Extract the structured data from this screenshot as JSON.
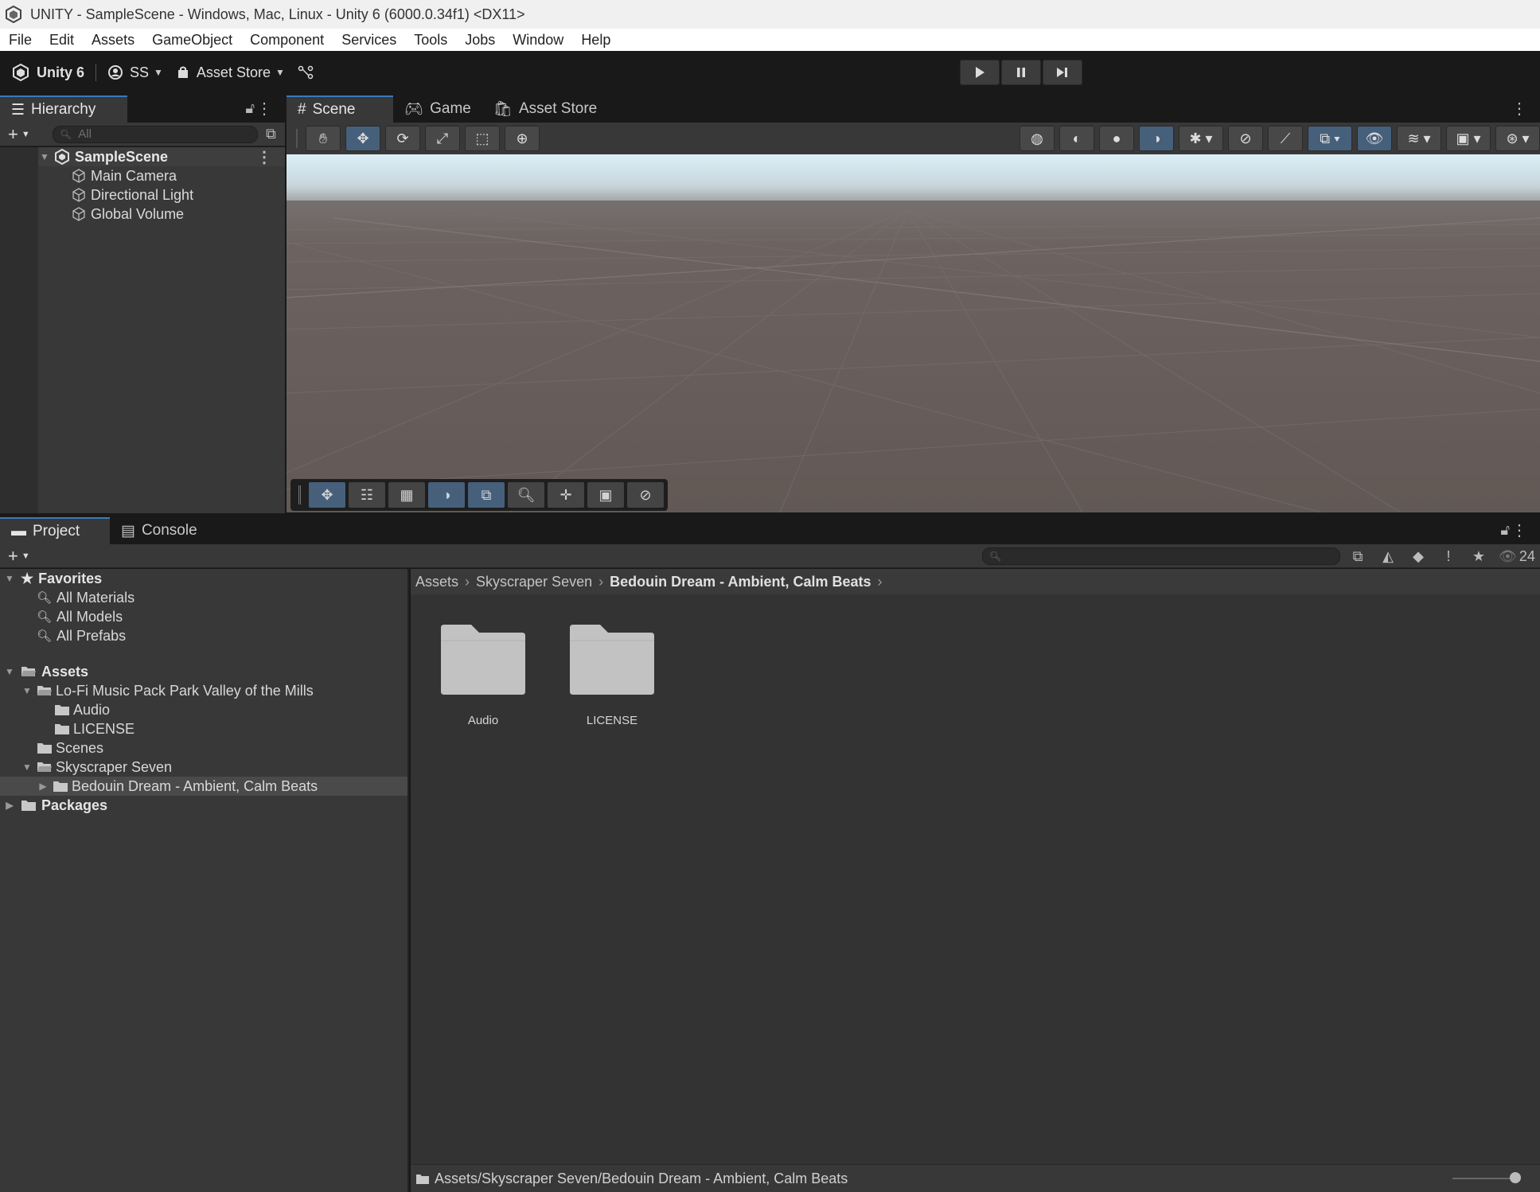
{
  "window": {
    "title": "UNITY - SampleScene - Windows, Mac, Linux - Unity 6 (6000.0.34f1) <DX11>"
  },
  "menu": [
    "File",
    "Edit",
    "Assets",
    "GameObject",
    "Component",
    "Services",
    "Tools",
    "Jobs",
    "Window",
    "Help"
  ],
  "toolbar": {
    "unity_label": "Unity 6",
    "account_label": "SS",
    "asset_store_label": "Asset Store"
  },
  "hierarchy": {
    "tab_label": "Hierarchy",
    "search_placeholder": "All",
    "scene_name": "SampleScene",
    "objects": [
      "Main Camera",
      "Directional Light",
      "Global Volume"
    ]
  },
  "scene_tabs": {
    "scene": "Scene",
    "game": "Game",
    "asset_store": "Asset Store"
  },
  "bottom_tabs": {
    "project": "Project",
    "console": "Console"
  },
  "project": {
    "hidden_count": "24",
    "favorites_label": "Favorites",
    "favorites": [
      "All Materials",
      "All Models",
      "All Prefabs"
    ],
    "assets_label": "Assets",
    "lofi_folder": "Lo-Fi Music Pack  Park Valley of the Mills",
    "lofi_children": [
      "Audio",
      "LICENSE"
    ],
    "scenes_folder": "Scenes",
    "skyscraper_folder": "Skyscraper Seven",
    "bedouin_folder": "Bedouin Dream - Ambient, Calm Beats",
    "packages_label": "Packages",
    "breadcrumb": [
      "Assets",
      "Skyscraper Seven",
      "Bedouin Dream - Ambient, Calm Beats"
    ],
    "tiles": [
      "Audio",
      "LICENSE"
    ],
    "status_path": "Assets/Skyscraper Seven/Bedouin Dream - Ambient, Calm Beats"
  }
}
